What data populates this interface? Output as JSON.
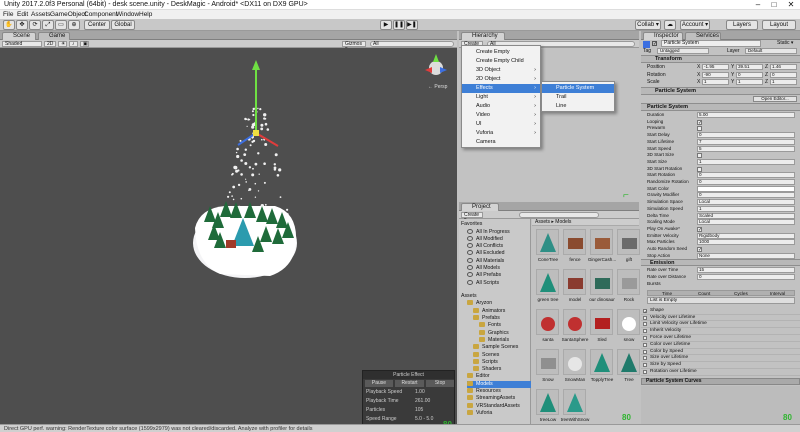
{
  "window": {
    "title": "Unity 2017.2.0f3 Personal (64bit) - desk scene.unity - DeskMagic - Android* <DX11 on DX9 GPU>",
    "min": "–",
    "max": "□",
    "close": "✕"
  },
  "menubar": [
    "File",
    "Edit",
    "Assets",
    "GameObject",
    "Component",
    "Window",
    "Help"
  ],
  "toolbar": {
    "pivot": "Center",
    "space": "Global",
    "collab": "Collab ▾",
    "account": "Account ▾",
    "layers": "Layers",
    "layout": "Layout"
  },
  "scene_panel": {
    "tabs": [
      "Scene",
      "Game"
    ],
    "shading": "Shaded",
    "mode_2d": "2D",
    "gizmos": "Gizmos ▾",
    "search": "All",
    "persp": "← Persp"
  },
  "particle_effect": {
    "title": "Particle Effect",
    "pause": "Pause",
    "restart": "Restart",
    "stop": "Stop",
    "rows": [
      {
        "label": "Playback Speed",
        "value": "1.00"
      },
      {
        "label": "Playback Time",
        "value": "261.00"
      },
      {
        "label": "Particles",
        "value": "105"
      },
      {
        "label": "Speed Range",
        "value": "5.0 - 5.0"
      }
    ]
  },
  "hierarchy": {
    "tab": "Hierarchy",
    "create": "Create ▾",
    "search": "All"
  },
  "create_menu": [
    {
      "label": "Create Empty",
      "sub": false
    },
    {
      "label": "Create Empty Child",
      "sub": false
    },
    {
      "label": "3D Object",
      "sub": true
    },
    {
      "label": "2D Object",
      "sub": true
    },
    {
      "label": "Effects",
      "sub": true,
      "hl": true
    },
    {
      "label": "Light",
      "sub": true
    },
    {
      "label": "Audio",
      "sub": true
    },
    {
      "label": "Video",
      "sub": true
    },
    {
      "label": "UI",
      "sub": true
    },
    {
      "label": "Vuforia",
      "sub": true
    },
    {
      "label": "Camera",
      "sub": false
    }
  ],
  "effects_menu": [
    {
      "label": "Particle System",
      "hl": true
    },
    {
      "label": "Trail"
    },
    {
      "label": "Line"
    }
  ],
  "project": {
    "tab": "Project",
    "create": "Create ▾",
    "breadcrumb": "Assets ▸ Models",
    "favorites": {
      "label": "Favorites",
      "items": [
        "All In Progress",
        "All Modified",
        "All Conflicts",
        "All Excluded",
        "All Materials",
        "All Models",
        "All Prefabs",
        "All Scripts"
      ]
    },
    "assets": {
      "label": "Assets",
      "items": [
        {
          "l": "Aryzon",
          "d": 1
        },
        {
          "l": "Animators",
          "d": 2
        },
        {
          "l": "Prefabs",
          "d": 2
        },
        {
          "l": "Fonts",
          "d": 3
        },
        {
          "l": "Graphics",
          "d": 3
        },
        {
          "l": "Materials",
          "d": 3
        },
        {
          "l": "Sample Scenes",
          "d": 2
        },
        {
          "l": "Scenes",
          "d": 2
        },
        {
          "l": "Scripts",
          "d": 2
        },
        {
          "l": "Shaders",
          "d": 2
        },
        {
          "l": "Editor",
          "d": 1
        },
        {
          "l": "Models",
          "d": 1,
          "sel": true
        },
        {
          "l": "Resources",
          "d": 1
        },
        {
          "l": "StreamingAssets",
          "d": 1
        },
        {
          "l": "VRStandardAssets",
          "d": 1
        },
        {
          "l": "Vuforia",
          "d": 1
        }
      ]
    },
    "grid": [
      {
        "name": "ConeTree",
        "color": "#2e8f86",
        "shape": "cone"
      },
      {
        "name": "fence",
        "color": "#8a4b2f",
        "shape": "box"
      },
      {
        "name": "GingerCash...",
        "color": "#9a5b3a",
        "shape": "box"
      },
      {
        "name": "gift",
        "color": "#6b6b6b",
        "shape": "box"
      },
      {
        "name": "green tree",
        "color": "#1f8f7a",
        "shape": "cone"
      },
      {
        "name": "model",
        "color": "#8a3b2f",
        "shape": "box"
      },
      {
        "name": "our dinosaur",
        "color": "#2f6b5a",
        "shape": "box"
      },
      {
        "name": "Rock",
        "color": "#9a9a9a",
        "shape": "box"
      },
      {
        "name": "santa",
        "color": "#c03030",
        "shape": "ball"
      },
      {
        "name": "SantaSphere",
        "color": "#c03030",
        "shape": "ball"
      },
      {
        "name": "Sled",
        "color": "#b32020",
        "shape": "box"
      },
      {
        "name": "snow",
        "color": "#ffffff",
        "shape": "ball"
      },
      {
        "name": "Snow",
        "color": "#8f8f8f",
        "shape": "box"
      },
      {
        "name": "SnowMan",
        "color": "#e6e6e6",
        "shape": "ball"
      },
      {
        "name": "TopplyTree",
        "color": "#1f8f7a",
        "shape": "cone"
      },
      {
        "name": "Tree",
        "color": "#1f7a6b",
        "shape": "cone"
      },
      {
        "name": "treeLow",
        "color": "#1f8f7a",
        "shape": "cone"
      },
      {
        "name": "treeWithSnow",
        "color": "#2a9a8a",
        "shape": "cone"
      }
    ]
  },
  "inspector": {
    "tabs": [
      "Inspector",
      "Services"
    ],
    "object_name": "Particle System",
    "static": "Static ▾",
    "tag_label": "Tag",
    "tag": "Untagged",
    "layer_label": "Layer",
    "layer": "Default",
    "transform": {
      "title": "Transform",
      "rows": [
        {
          "label": "Position",
          "x": "-1.95",
          "y": "39.51",
          "z": "1.46"
        },
        {
          "label": "Rotation",
          "x": "-90",
          "y": "0",
          "z": "0"
        },
        {
          "label": "Scale",
          "x": "1",
          "y": "1",
          "z": "1"
        }
      ]
    },
    "ps": {
      "title": "Particle System",
      "open": "Open Editor...",
      "sub": "Particle System",
      "rows": [
        {
          "l": "Duration",
          "v": "5.00"
        },
        {
          "l": "Looping",
          "c": "✓"
        },
        {
          "l": "Prewarm",
          "c": ""
        },
        {
          "l": "Start Delay",
          "v": "0"
        },
        {
          "l": "Start Lifetime",
          "v": "7"
        },
        {
          "l": "Start Speed",
          "v": "5"
        },
        {
          "l": "3D Start Size",
          "c": ""
        },
        {
          "l": "Start Size",
          "v": "1"
        },
        {
          "l": "3D Start Rotation",
          "c": ""
        },
        {
          "l": "Start Rotation",
          "v": "0"
        },
        {
          "l": "Randomize Rotation",
          "v": "0"
        },
        {
          "l": "Start Color",
          "v": ""
        },
        {
          "l": "Gravity Modifier",
          "v": "0"
        },
        {
          "l": "Simulation Space",
          "v": "Local"
        },
        {
          "l": "Simulation Speed",
          "v": "1"
        },
        {
          "l": "Delta Time",
          "v": "Scaled"
        },
        {
          "l": "Scaling Mode",
          "v": "Local"
        },
        {
          "l": "Play On Awake*",
          "c": "✓"
        },
        {
          "l": "Emitter Velocity",
          "v": "Rigidbody"
        },
        {
          "l": "Max Particles",
          "v": "1000"
        },
        {
          "l": "Auto Random Seed",
          "c": "✓"
        },
        {
          "l": "Stop Action",
          "v": "None"
        }
      ],
      "emission": "Emission",
      "rate_time_label": "Rate over Time",
      "rate_time": "15",
      "rate_dist_label": "Rate over Distance",
      "rate_dist": "0",
      "bursts": "Bursts",
      "burst_cols": [
        "Time",
        "Count",
        "Cycles",
        "Interval"
      ],
      "list_empty": "List is Empty",
      "modules": [
        {
          "n": "Shape",
          "c": true
        },
        {
          "n": "Velocity over Lifetime"
        },
        {
          "n": "Limit Velocity over Lifetime"
        },
        {
          "n": "Inherit Velocity"
        },
        {
          "n": "Force over Lifetime"
        },
        {
          "n": "Color over Lifetime"
        },
        {
          "n": "Color by Speed"
        },
        {
          "n": "Size over Lifetime"
        },
        {
          "n": "Size by Speed"
        },
        {
          "n": "Rotation over Lifetime"
        }
      ],
      "curves": "Particle System Curves"
    }
  },
  "fps": [
    "80",
    "80",
    "80"
  ],
  "status": "Direct GPU perf. warning: RenderTexture color surface (1599x2979) was not cleared/discarded. Analyze with profiler for details"
}
